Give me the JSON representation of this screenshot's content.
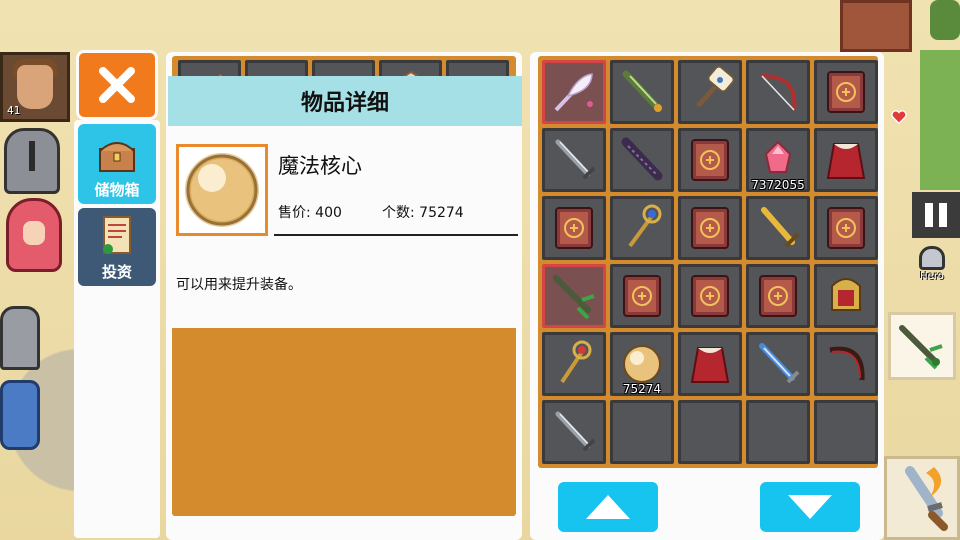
{
  "hero": {
    "level": "41"
  },
  "hud": {
    "hero_button_label": "Hero"
  },
  "tabs": [
    {
      "label": "储物箱",
      "icon": "chest-icon",
      "active": true
    },
    {
      "label": "投资",
      "icon": "scroll-icon",
      "active": false
    }
  ],
  "detail": {
    "title": "物品详细",
    "item_name": "魔法核心",
    "price_text": "售价: 400",
    "count_text": "个数: 75274",
    "description": "可以用来提升装备。"
  },
  "storage": {
    "cells": [
      {
        "icon": "flame-staff-icon",
        "count": ""
      },
      {
        "icon": "empty",
        "count": ""
      },
      {
        "icon": "empty",
        "count": ""
      },
      {
        "icon": "crystal-shield-icon",
        "count": ""
      },
      {
        "icon": "empty",
        "count": ""
      },
      {
        "icon": "empty",
        "count": ""
      },
      {
        "icon": "empty",
        "count": ""
      },
      {
        "icon": "empty",
        "count": ""
      },
      {
        "icon": "orange-gem-icon",
        "count": ""
      },
      {
        "icon": "empty",
        "count": ""
      },
      {
        "icon": "empty",
        "count": ""
      },
      {
        "icon": "red-spear-icon",
        "count": ""
      },
      {
        "icon": "moon-staff-icon",
        "count": ""
      },
      {
        "icon": "amber-drop-icon",
        "count": ""
      },
      {
        "icon": "dark-spear-icon",
        "count": ""
      }
    ]
  },
  "inventory": {
    "cells": [
      {
        "icon": "feather-staff-icon",
        "count": "",
        "selected": true
      },
      {
        "icon": "green-sword-icon",
        "count": ""
      },
      {
        "icon": "hammer-icon",
        "count": ""
      },
      {
        "icon": "bow-icon",
        "count": ""
      },
      {
        "icon": "spellbook-icon",
        "count": ""
      },
      {
        "icon": "iron-sword-icon",
        "count": ""
      },
      {
        "icon": "dark-blade-icon",
        "count": ""
      },
      {
        "icon": "spellbook-icon",
        "count": ""
      },
      {
        "icon": "pink-gem-icon",
        "count": "7372055"
      },
      {
        "icon": "red-cape-icon",
        "count": ""
      },
      {
        "icon": "spellbook-icon",
        "count": ""
      },
      {
        "icon": "blue-staff-icon",
        "count": ""
      },
      {
        "icon": "spellbook-icon",
        "count": ""
      },
      {
        "icon": "gold-sword-icon",
        "count": ""
      },
      {
        "icon": "spellbook-icon",
        "count": ""
      },
      {
        "icon": "vine-sword-icon",
        "count": "",
        "selected": true
      },
      {
        "icon": "spellbook-icon",
        "count": ""
      },
      {
        "icon": "spellbook-icon",
        "count": ""
      },
      {
        "icon": "spellbook-icon",
        "count": ""
      },
      {
        "icon": "armor-icon",
        "count": ""
      },
      {
        "icon": "ruby-staff-icon",
        "count": ""
      },
      {
        "icon": "magic-core-icon",
        "count": "75274"
      },
      {
        "icon": "red-cape-icon",
        "count": ""
      },
      {
        "icon": "ice-sword-icon",
        "count": ""
      },
      {
        "icon": "dark-bow-icon",
        "count": ""
      },
      {
        "icon": "iron-sword-icon",
        "count": ""
      },
      {
        "icon": "empty",
        "count": ""
      },
      {
        "icon": "empty",
        "count": ""
      },
      {
        "icon": "empty",
        "count": ""
      },
      {
        "icon": "empty",
        "count": ""
      }
    ]
  },
  "colors": {
    "close": "#f17a1c",
    "tab_active": "#2ec4e8",
    "tab_inactive": "#3d5975",
    "grid_frame": "#d38b2d",
    "cell": "#545558",
    "header": "#a6e0e7",
    "scroll_button": "#17c3ef"
  }
}
